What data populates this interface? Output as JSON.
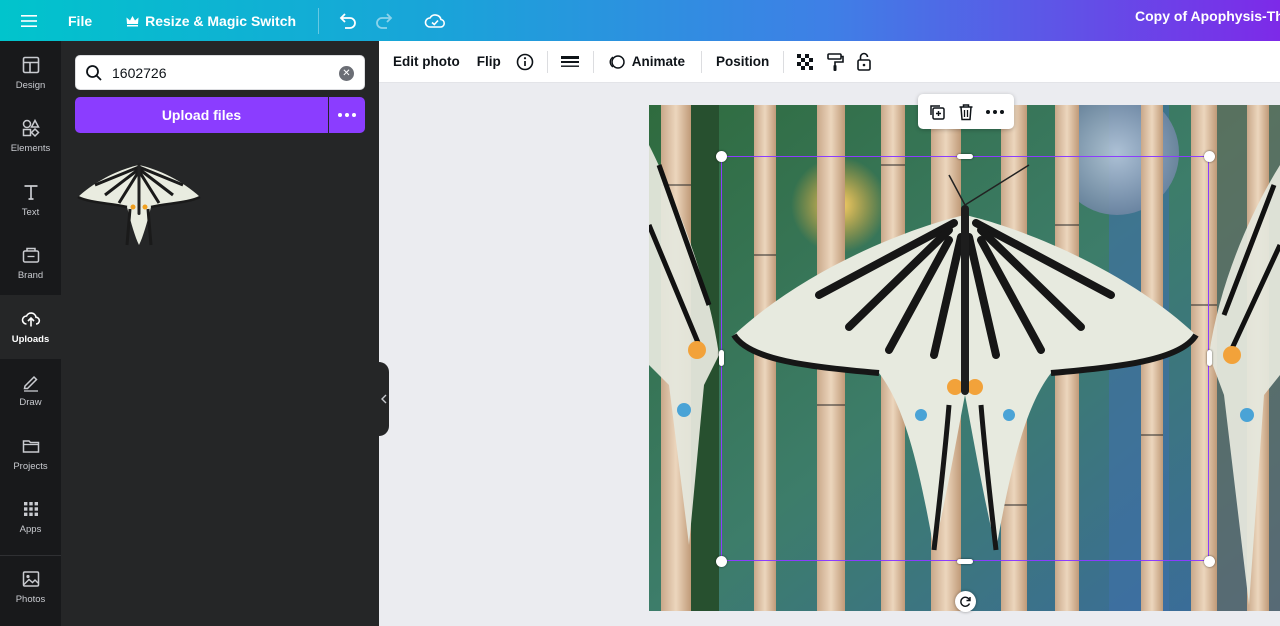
{
  "topbar": {
    "file_label": "File",
    "resize_label": "Resize & Magic Switch",
    "doc_title": "Copy of Apophysis-The"
  },
  "rail": {
    "items": [
      {
        "label": "Design",
        "icon": "layout-icon"
      },
      {
        "label": "Elements",
        "icon": "shapes-icon"
      },
      {
        "label": "Text",
        "icon": "text-icon"
      },
      {
        "label": "Brand",
        "icon": "brand-icon"
      },
      {
        "label": "Uploads",
        "icon": "cloud-upload-icon",
        "active": true
      },
      {
        "label": "Draw",
        "icon": "pen-icon"
      },
      {
        "label": "Projects",
        "icon": "folder-icon"
      },
      {
        "label": "Apps",
        "icon": "apps-grid-icon"
      },
      {
        "label": "Photos",
        "icon": "image-icon"
      }
    ]
  },
  "panel": {
    "search_value": "1602726",
    "upload_label": "Upload files"
  },
  "context_toolbar": {
    "edit_photo": "Edit photo",
    "flip": "Flip",
    "animate": "Animate",
    "position": "Position"
  },
  "colors": {
    "accent": "#8b3dff",
    "rail_bg": "#18191b",
    "panel_bg": "#252627"
  }
}
